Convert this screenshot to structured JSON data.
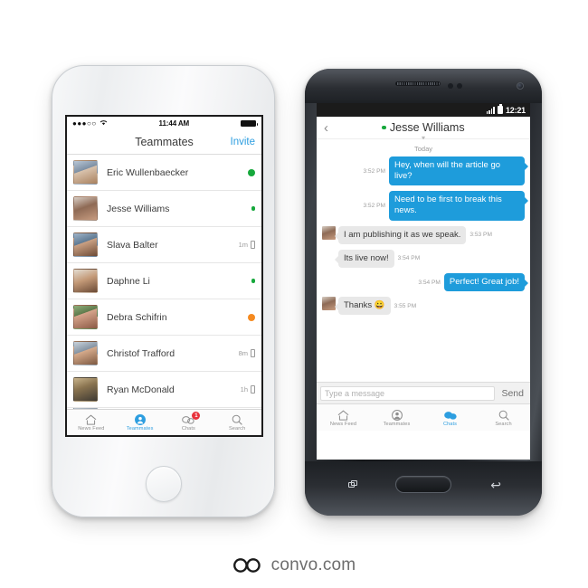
{
  "iphone": {
    "status": {
      "carrier_dots": "●●●○○",
      "wifi_icon": "wifi-icon",
      "time": "11:44 AM",
      "battery_icon": "battery-full-icon"
    },
    "navbar": {
      "title": "Teammates",
      "invite_label": "Invite"
    },
    "contacts": [
      {
        "name": "Eric Wullenbaecker",
        "status_color": "#16a83c",
        "dot_size": "big",
        "ago": "",
        "has_device": false
      },
      {
        "name": "Jesse Williams",
        "status_color": "#16a83c",
        "dot_size": "small",
        "ago": "",
        "has_device": false
      },
      {
        "name": "Slava Balter",
        "status_color": "",
        "dot_size": "",
        "ago": "1m",
        "has_device": true
      },
      {
        "name": "Daphne Li",
        "status_color": "#16a83c",
        "dot_size": "small",
        "ago": "",
        "has_device": false
      },
      {
        "name": "Debra Schifrin",
        "status_color": "#f58a20",
        "dot_size": "big",
        "ago": "",
        "has_device": false
      },
      {
        "name": "Christof Trafford",
        "status_color": "",
        "dot_size": "",
        "ago": "8m",
        "has_device": true
      },
      {
        "name": "Ryan McDonald",
        "status_color": "",
        "dot_size": "",
        "ago": "1h",
        "has_device": true
      }
    ],
    "tabs": [
      {
        "label": "News Feed",
        "icon": "home-icon",
        "active": false,
        "badge": ""
      },
      {
        "label": "Teammates",
        "icon": "person-icon",
        "active": true,
        "badge": ""
      },
      {
        "label": "Chats",
        "icon": "chat-icon",
        "active": false,
        "badge": "1"
      },
      {
        "label": "Search",
        "icon": "search-icon",
        "active": false,
        "badge": ""
      }
    ]
  },
  "android": {
    "status": {
      "signal_icon": "signal-bars-icon",
      "battery_icon": "battery-icon",
      "time": "12:21"
    },
    "navbar": {
      "back_icon": "chevron-left-icon",
      "presence_color": "#16a83c",
      "title": "Jesse Williams",
      "chevron_icon": "chevron-down-icon"
    },
    "thread": {
      "day_separator": "Today",
      "messages": [
        {
          "side": "out",
          "text": "Hey, when will the article go live?",
          "time": "3:52 PM",
          "avatar": false
        },
        {
          "side": "out",
          "text": "Need to be first to break this news.",
          "time": "3:52 PM",
          "avatar": false
        },
        {
          "side": "in",
          "text": "I am publishing it as we speak.",
          "time": "3:53 PM",
          "avatar": true
        },
        {
          "side": "in",
          "text": "Its live now!",
          "time": "3:54 PM",
          "avatar": false
        },
        {
          "side": "out",
          "text": "Perfect! Great job!",
          "time": "3:54 PM",
          "avatar": false
        },
        {
          "side": "in",
          "text": "Thanks 😀",
          "time": "3:55 PM",
          "avatar": true
        }
      ]
    },
    "composer": {
      "placeholder": "Type a message",
      "value": "",
      "send_label": "Send"
    },
    "tabs": [
      {
        "label": "News Feed",
        "icon": "home-icon",
        "active": false
      },
      {
        "label": "Teammates",
        "icon": "person-icon",
        "active": false
      },
      {
        "label": "Chats",
        "icon": "chat-icon",
        "active": true
      },
      {
        "label": "Search",
        "icon": "search-icon",
        "active": false
      }
    ],
    "hardware": {
      "recent_icon": "recent-apps-icon",
      "home_icon": "home-button",
      "back_icon": "back-arrow-icon"
    }
  },
  "branding": {
    "logo_mark": "convo-infinity-logo",
    "logo_text": "convo.com"
  },
  "theme": {
    "accent_blue": "#1e9cdb",
    "link_blue": "#2d9ee0",
    "online_green": "#16a83c",
    "away_orange": "#f58a20",
    "badge_red": "#e8323c",
    "bubble_grey": "#e8e8e8"
  }
}
